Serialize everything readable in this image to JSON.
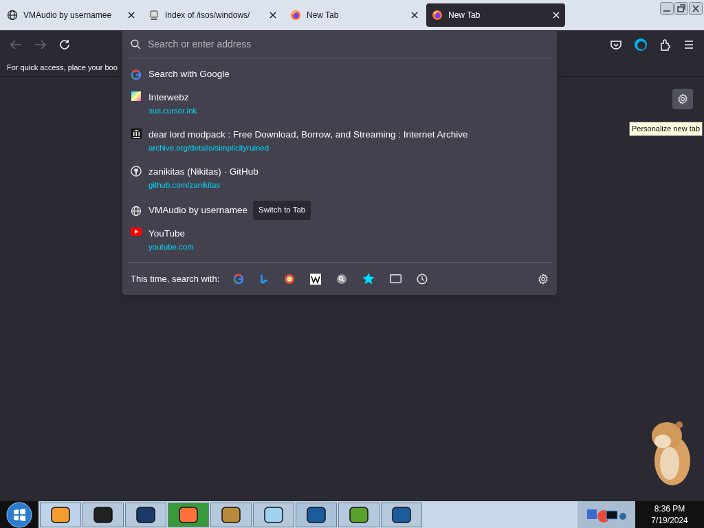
{
  "tabs": [
    {
      "title": "VMAudio by usernamee",
      "selected": false
    },
    {
      "title": "Index of /isos/windows/",
      "selected": false
    },
    {
      "title": "New Tab",
      "selected": false
    },
    {
      "title": "New Tab",
      "selected": true
    }
  ],
  "toolbar": {
    "back_disabled": true,
    "forward_disabled": true
  },
  "bookmarks_hint": "For quick access, place your boo",
  "address": {
    "placeholder": "Search or enter address"
  },
  "results": [
    {
      "kind": "search",
      "title": "Search with Google"
    },
    {
      "kind": "site",
      "title": "Interwebz",
      "url": "sus.cursor.ink"
    },
    {
      "kind": "site",
      "title": "dear lord modpack : Free Download, Borrow, and Streaming : Internet Archive",
      "url": "archive.org/details/simplicityruined"
    },
    {
      "kind": "site",
      "title": "zanikitas (Nikitas) · GitHub",
      "url": "github.com/zanikitas"
    },
    {
      "kind": "tab",
      "title": "VMAudio by usernamee",
      "action": "Switch to Tab"
    },
    {
      "kind": "site",
      "title": "YouTube",
      "url": "youtube.com"
    }
  ],
  "search_with": {
    "label": "This time, search with:"
  },
  "tooltip": "Personalize new tab",
  "clock": {
    "time": "8:36 PM",
    "date": "7/19/2024"
  }
}
